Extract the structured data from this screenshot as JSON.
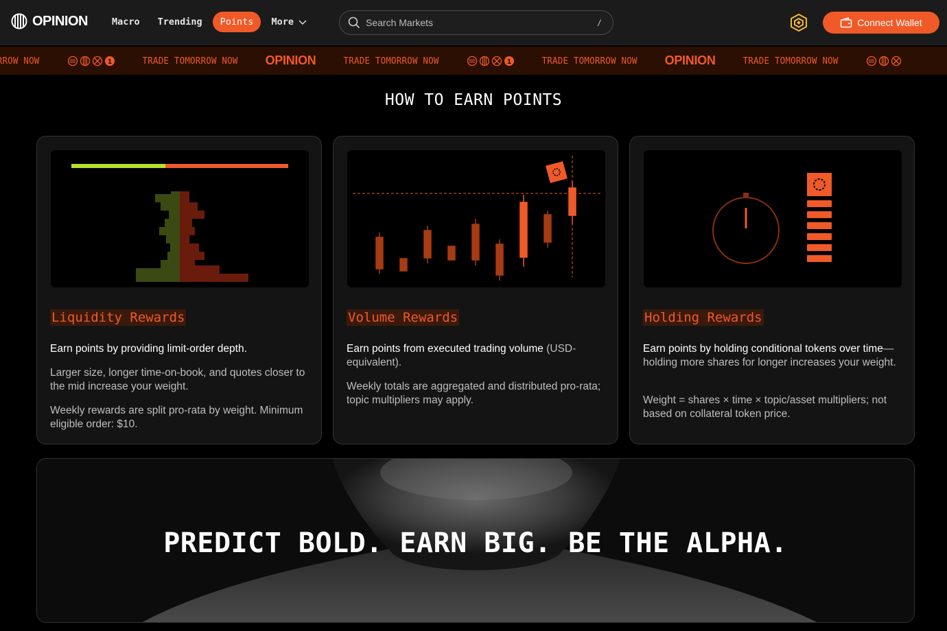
{
  "header": {
    "logo_text": "OPINION",
    "nav": [
      {
        "label": "Macro",
        "active": false
      },
      {
        "label": "Trending",
        "active": false
      },
      {
        "label": "Points",
        "active": true
      },
      {
        "label": "More",
        "active": false
      }
    ],
    "search_placeholder": "Search Markets",
    "search_shortcut": "/",
    "connect_wallet_label": "Connect Wallet"
  },
  "ticker": {
    "phrase_partial": "ORROW NOW",
    "phrase": "TRADE TOMORROW NOW",
    "logo_text": "OPINION",
    "accent_color": "#f05a28",
    "background_color": "#2b0f03"
  },
  "section_title": "HOW TO EARN POINTS",
  "cards": [
    {
      "title": "Liquidity Rewards",
      "lead": "Earn points by providing limit-order depth.",
      "lead_muted": "",
      "paragraphs": [
        "Larger size, longer time-on-book, and quotes closer to the mid increase your weight.",
        "Weekly rewards are split pro-rata by weight. Minimum eligible order: $10."
      ]
    },
    {
      "title": "Volume Rewards",
      "lead": "Earn points from executed trading volume",
      "lead_muted": " (USD-equivalent).",
      "paragraphs": [
        "Weekly totals are aggregated and distributed pro-rata; topic multipliers may apply."
      ]
    },
    {
      "title": "Holding Rewards",
      "lead": "Earn points by holding conditional tokens over time",
      "lead_muted": "—holding more shares for longer increases your weight.",
      "paragraphs": [
        "Weight = shares × time × topic/asset multipliers; not based on collateral token price."
      ]
    }
  ],
  "banner_text": "PREDICT BOLD. EARN BIG. BE THE ALPHA.",
  "colors": {
    "accent": "#f05a28",
    "bid_green": "#b8e02a",
    "card_bg": "#141414",
    "page_bg": "#000000"
  }
}
